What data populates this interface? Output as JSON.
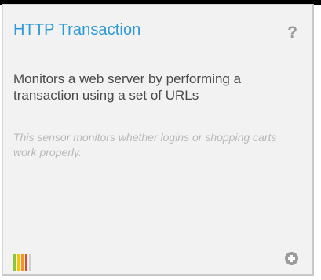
{
  "card": {
    "title": "HTTP Transaction",
    "help_symbol": "?",
    "description": "Monitors a web server by performing a transaction using a set of URLs",
    "note": "This sensor monitors whether logins or shopping carts work properly.",
    "priority_bar_colors": [
      "#8cc63f",
      "#f2c500",
      "#f7931e",
      "#e8462b",
      "#cfcfcf"
    ],
    "add_icon": "plus-circle-icon",
    "colors": {
      "title": "#2d9bd6",
      "background": "#f2f2f2",
      "description": "#4a4a4a",
      "note": "#b8b8b8"
    }
  }
}
